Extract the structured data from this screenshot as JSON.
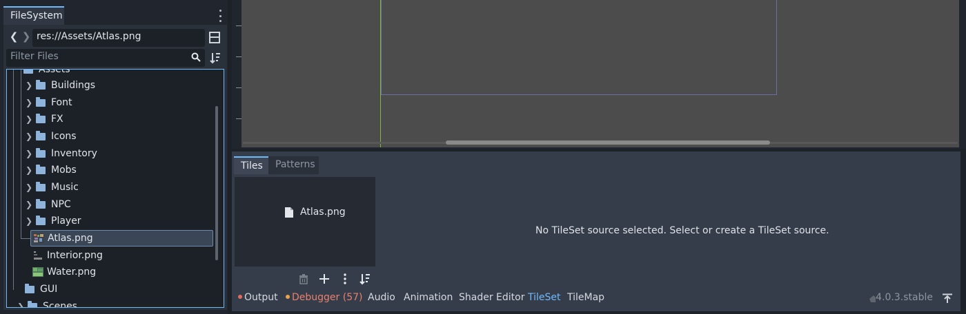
{
  "filesystem": {
    "tab_label": "FileSystem",
    "path": "res://Assets/Atlas.png",
    "filter_placeholder": "Filter Files",
    "tree": {
      "root_label": "Assets",
      "folders": [
        "Buildings",
        "Font",
        "FX",
        "Icons",
        "Inventory",
        "Mobs",
        "Music",
        "NPC",
        "Player"
      ],
      "files": [
        {
          "label": "Atlas.png",
          "selected": true
        },
        {
          "label": "Interior.png",
          "selected": false
        },
        {
          "label": "Water.png",
          "selected": false
        }
      ],
      "bottom_folders": [
        "GUI",
        "Scenes"
      ]
    }
  },
  "bottom_panel": {
    "tabs": [
      {
        "label": "Tiles",
        "active": true
      },
      {
        "label": "Patterns",
        "active": false
      }
    ],
    "source_entry": "Atlas.png",
    "empty_message": "No TileSet source selected. Select or create a TileSet source."
  },
  "bottom_bar": {
    "items": [
      {
        "label": "Output",
        "dot_color": "#e06c5b",
        "color": "#d5dae1"
      },
      {
        "label": "Debugger (57)",
        "dot_color": "#e8a54a",
        "color": "#e8806e"
      },
      {
        "label": "Audio",
        "color": "#d5dae1"
      },
      {
        "label": "Animation",
        "color": "#d5dae1"
      },
      {
        "label": "Shader Editor",
        "color": "#d5dae1"
      },
      {
        "label": "TileSet",
        "color": "#70bafa"
      },
      {
        "label": "TileMap",
        "color": "#d5dae1"
      }
    ],
    "version": "4.0.3.stable"
  },
  "colors": {
    "accent": "#70bafa",
    "selection": "#3a4656",
    "viewport": "#4c4c4c"
  }
}
